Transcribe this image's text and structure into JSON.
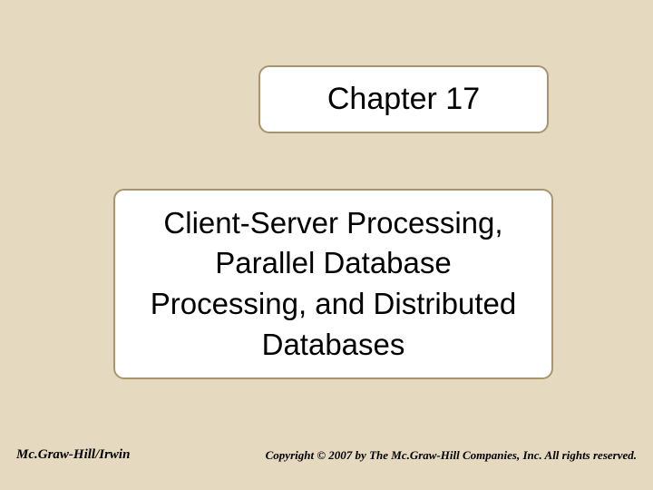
{
  "chapter": {
    "label": "Chapter 17"
  },
  "content": {
    "title": "Client-Server Processing, Parallel Database Processing, and Distributed Databases"
  },
  "footer": {
    "publisher": "Mc.Graw-Hill/Irwin",
    "copyright": "Copyright © 2007 by The Mc.Graw-Hill Companies, Inc. All rights reserved."
  }
}
